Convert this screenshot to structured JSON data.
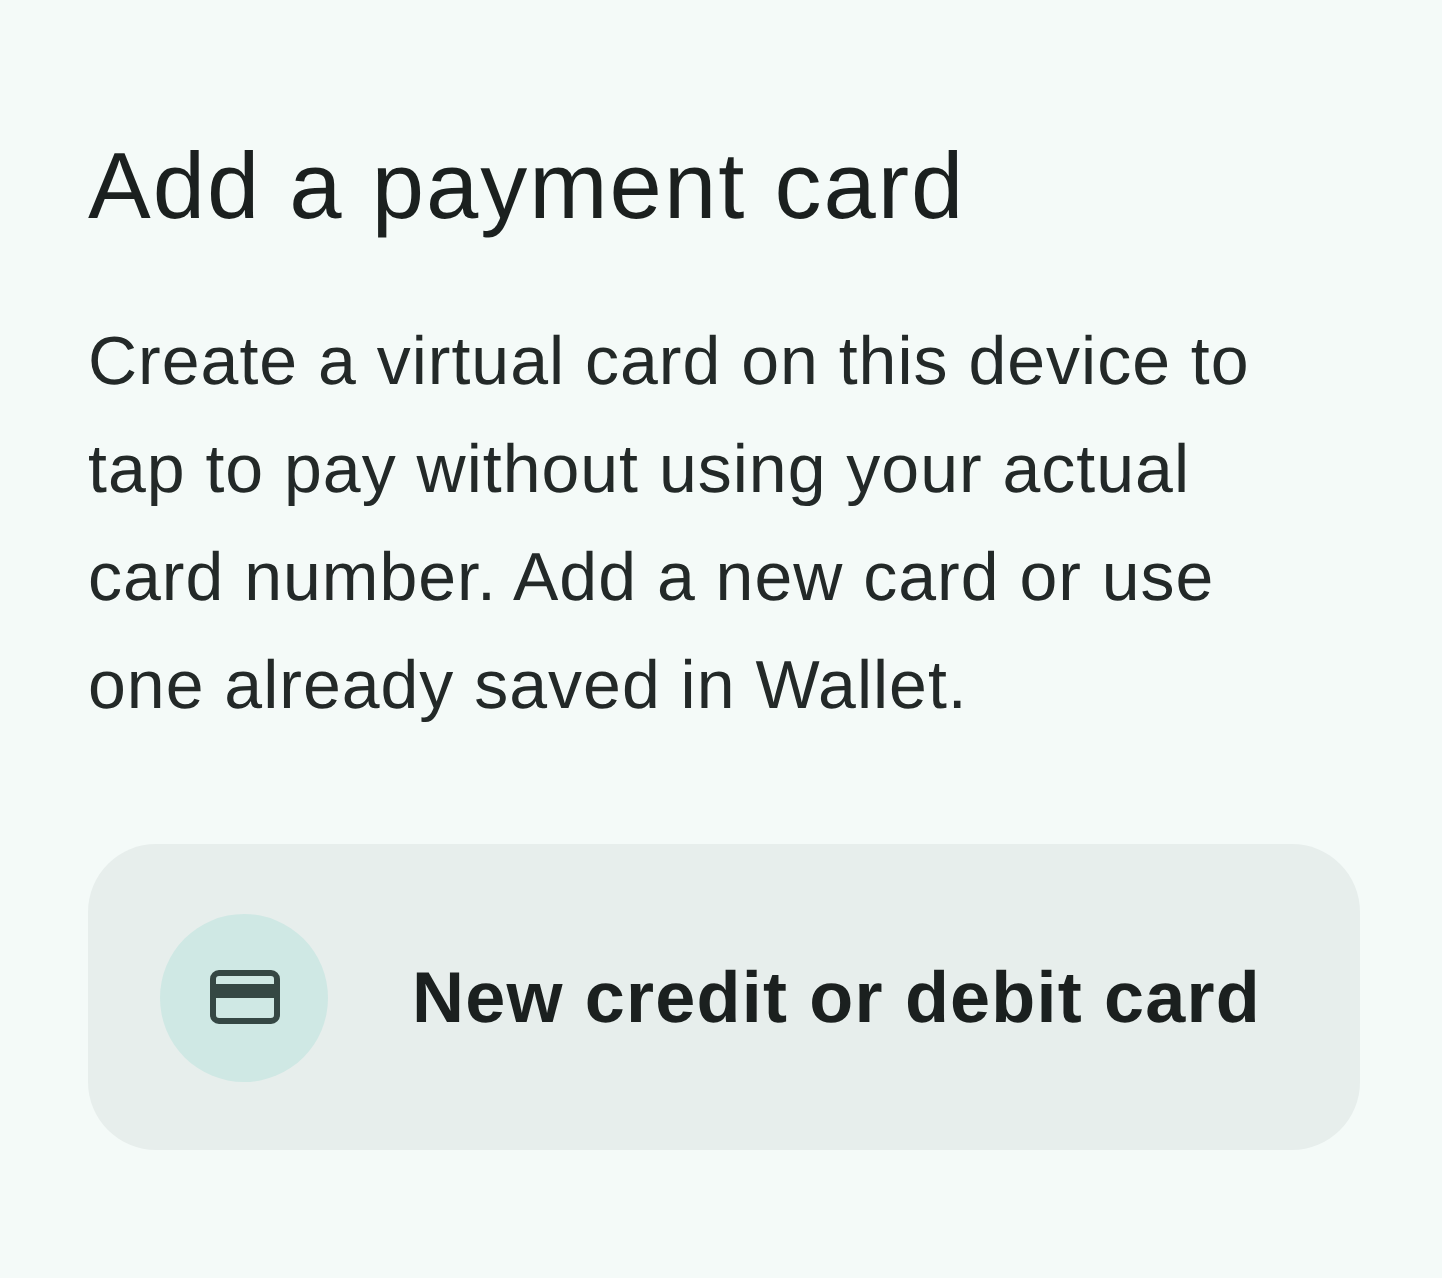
{
  "heading": "Add a payment card",
  "description": "Create a virtual card on this device to tap to pay without using your actual card number. Add a new card or use one already saved in Wallet.",
  "options": [
    {
      "kind": "new_card",
      "label": "New credit or debit card"
    }
  ]
}
